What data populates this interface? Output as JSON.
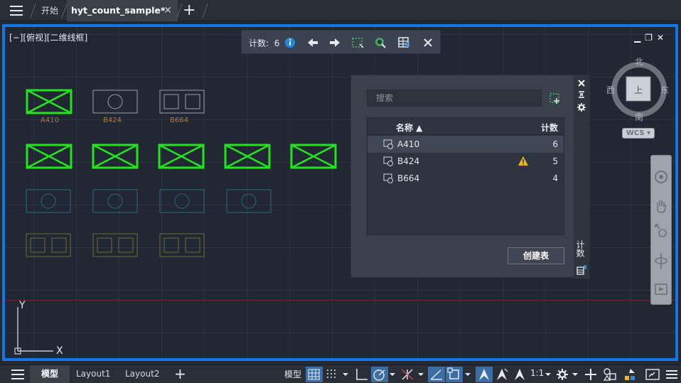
{
  "top_bar": {
    "tabs": [
      {
        "label": "开始"
      },
      {
        "label": "hyt_count_sample*"
      }
    ],
    "close_glyph": "✕",
    "new_tab_glyph": "+"
  },
  "viewport": {
    "view_label": "[−][俯视][二维线框]",
    "window_controls": "▁❐✕",
    "count_toolbar": {
      "label": "计数:",
      "count": "6"
    },
    "blocks": {
      "top_row_labels": [
        "A410",
        "B424",
        "B664"
      ]
    },
    "ucs": {
      "y_label": "Y",
      "x_label": "X"
    }
  },
  "count_palette": {
    "search_placeholder": "搜索",
    "columns": {
      "name": "名称 ▲",
      "count": "计数"
    },
    "rows": [
      {
        "name": "A410",
        "count": "6",
        "warning": false
      },
      {
        "name": "B424",
        "count": "5",
        "warning": true
      },
      {
        "name": "B664",
        "count": "4",
        "warning": false
      }
    ],
    "create_table_label": "创建表",
    "side_title": "计数"
  },
  "viewcube": {
    "north": "北",
    "south": "南",
    "east": "东",
    "west": "西",
    "top_face": "上",
    "wcs_label": "WCS"
  },
  "status_bar": {
    "layout_tabs": [
      {
        "label": "模型"
      },
      {
        "label": "Layout1"
      },
      {
        "label": "Layout2"
      }
    ],
    "new_layout_glyph": "+",
    "model_label": "模型",
    "scale_label": "1:1"
  },
  "colors": {
    "accent": "#1476e2",
    "selected_green": "#22e51e",
    "block_label": "#b47a37"
  }
}
